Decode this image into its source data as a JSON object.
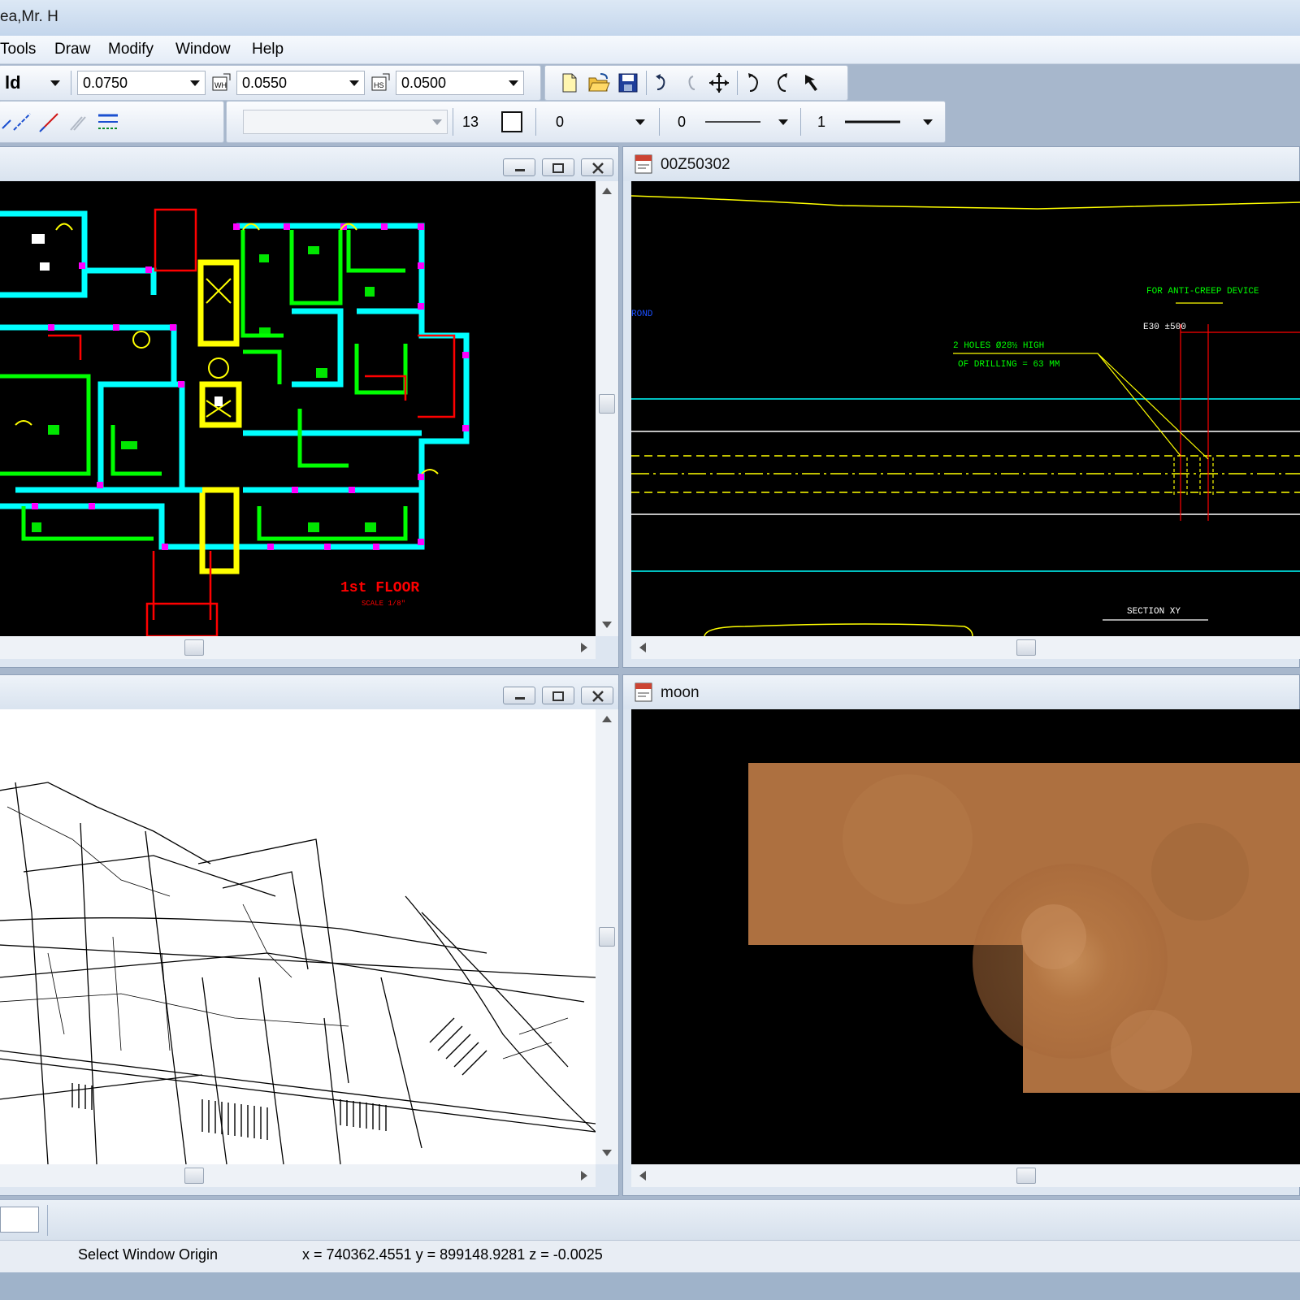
{
  "window": {
    "title": "ea,Mr. H"
  },
  "menu": {
    "items": [
      "Tools",
      "Draw",
      "Modify",
      "Window",
      "Help"
    ],
    "accelerators": [
      "T",
      "D",
      "M",
      "W",
      "H"
    ]
  },
  "toolbar1": {
    "style_value": "ld",
    "combo1_value": "0.0750",
    "combo2_value": "0.0550",
    "combo3_value": "0.0500"
  },
  "toolbar2": {
    "text_size": "13",
    "level_value": "0",
    "style_value": "0",
    "weight_value": "1"
  },
  "panes": {
    "top_right_title": "00Z50302",
    "bottom_right_title": "moon"
  },
  "cad_annotations": {
    "floor_label": "1st FLOOR",
    "floor_sublabel": "SCALE 1/8\"",
    "anti_creep": "FOR ANTI-CREEP DEVICE",
    "dims": "E30 ±500",
    "holes": "2 HOLES Ø28½ HIGH",
    "drilling": "OF DRILLING = 63 MM",
    "section": "SECTION XY",
    "side_label": "ROND"
  },
  "status": {
    "prompt": "Select Window Origin",
    "coords": "x = 740362.4551 y = 899148.9281 z = -0.0025"
  },
  "colors": {
    "cad_bg": "#000000",
    "yellow": "#ffff00",
    "cyan": "#00ffff",
    "green": "#00ff00",
    "red": "#ff0000",
    "magenta": "#ff00ff"
  }
}
